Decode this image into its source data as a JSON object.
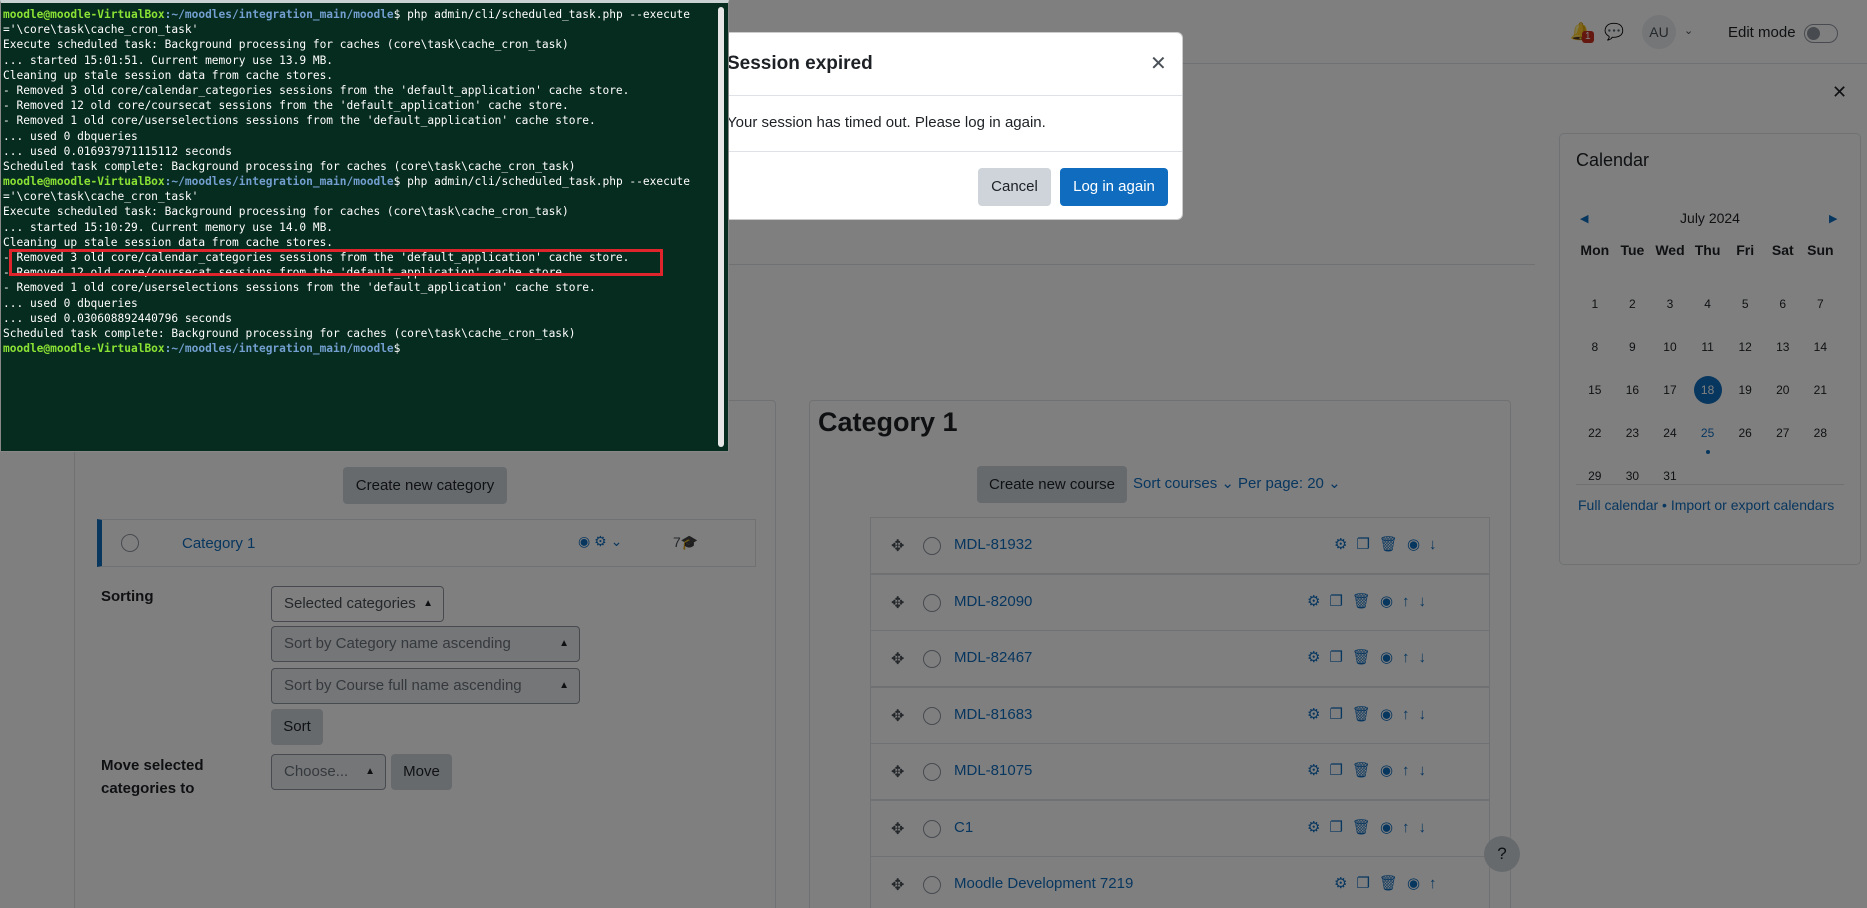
{
  "header": {
    "notification_count": "1",
    "avatar_initials": "AU",
    "edit_mode_label": "Edit mode"
  },
  "modal": {
    "title": "Session expired",
    "body": "Your session has timed out. Please log in again.",
    "cancel_label": "Cancel",
    "login_label": "Log in again"
  },
  "calendar": {
    "title": "Calendar",
    "month": "July 2024",
    "weekdays": [
      "Mon",
      "Tue",
      "Wed",
      "Thu",
      "Fri",
      "Sat",
      "Sun"
    ],
    "days": [
      "1",
      "2",
      "3",
      "4",
      "5",
      "6",
      "7",
      "8",
      "9",
      "10",
      "11",
      "12",
      "13",
      "14",
      "15",
      "16",
      "17",
      "18",
      "19",
      "20",
      "21",
      "22",
      "23",
      "24",
      "25",
      "26",
      "27",
      "28",
      "29",
      "30",
      "31"
    ],
    "today": "18",
    "event_day": "25",
    "links": "Full calendar • Import or export calendars"
  },
  "left": {
    "create_category": "Create new category",
    "category_name": "Category 1",
    "category_count": "7",
    "sorting_label": "Sorting",
    "sort_select": "Selected categories",
    "sort_category": "Sort by Category name ascending",
    "sort_course": "Sort by Course full name ascending",
    "sort_button": "Sort",
    "move_label": "Move selected categories to",
    "move_select": "Choose...",
    "move_button": "Move"
  },
  "right": {
    "title": "Category 1",
    "create_course": "Create new course",
    "sort_courses": "Sort courses",
    "per_page": "Per page: 20",
    "courses": [
      {
        "name": "MDL-81932",
        "icons": "⚙❐🗑◉↓"
      },
      {
        "name": "MDL-82090",
        "icons": "⚙❐🗑◉↑↓"
      },
      {
        "name": "MDL-82467",
        "icons": "⚙❐🗑◉↑↓"
      },
      {
        "name": "MDL-81683",
        "icons": "⚙❐🗑◉↑↓"
      },
      {
        "name": "MDL-81075",
        "icons": "⚙❐🗑◉↑↓"
      },
      {
        "name": "C1",
        "icons": "⚙❐🗑◉↑↓"
      },
      {
        "name": "Moodle Development 7219",
        "icons": "⚙❐🗑◉↑"
      }
    ]
  },
  "help_label": "?",
  "terminal": {
    "prompt_user": "moodle@moodle-VirtualBox",
    "prompt_path": ":~/moodles/integration_main/moodle",
    "command": "$ php admin/cli/scheduled_task.php --execute",
    "command_cont": "='\\core\\task\\cache_cron_task'",
    "lines": [
      "Execute scheduled task: Background processing for caches (core\\task\\cache_cron_task)",
      "... started 15:01:51. Current memory use 13.9 MB.",
      "Cleaning up stale session data from cache stores.",
      "- Removed 3 old core/calendar_categories sessions from the 'default_application' cache store.",
      "- Removed 12 old core/coursecat sessions from the 'default_application' cache store.",
      "- Removed 1 old core/userselections sessions from the 'default_application' cache store.",
      "... used 0 dbqueries",
      "... used 0.016937971115112 seconds",
      "Scheduled task complete: Background processing for caches (core\\task\\cache_cron_task)"
    ],
    "lines2": [
      "Execute scheduled task: Background processing for caches (core\\task\\cache_cron_task)",
      "... started 15:10:29. Current memory use 14.0 MB.",
      "Cleaning up stale session data from cache stores.",
      "- Removed 3 old core/calendar_categories sessions from the 'default_application' cache store.",
      "- Removed 12 old core/coursecat sessions from the 'default_application' cache store.",
      "- Removed 1 old core/userselections sessions from the 'default_application' cache store.",
      "... used 0 dbqueries",
      "... used 0.030608892440796 seconds",
      "Scheduled task complete: Background processing for caches (core\\task\\cache_cron_task)"
    ],
    "final_prompt_end": "$"
  }
}
